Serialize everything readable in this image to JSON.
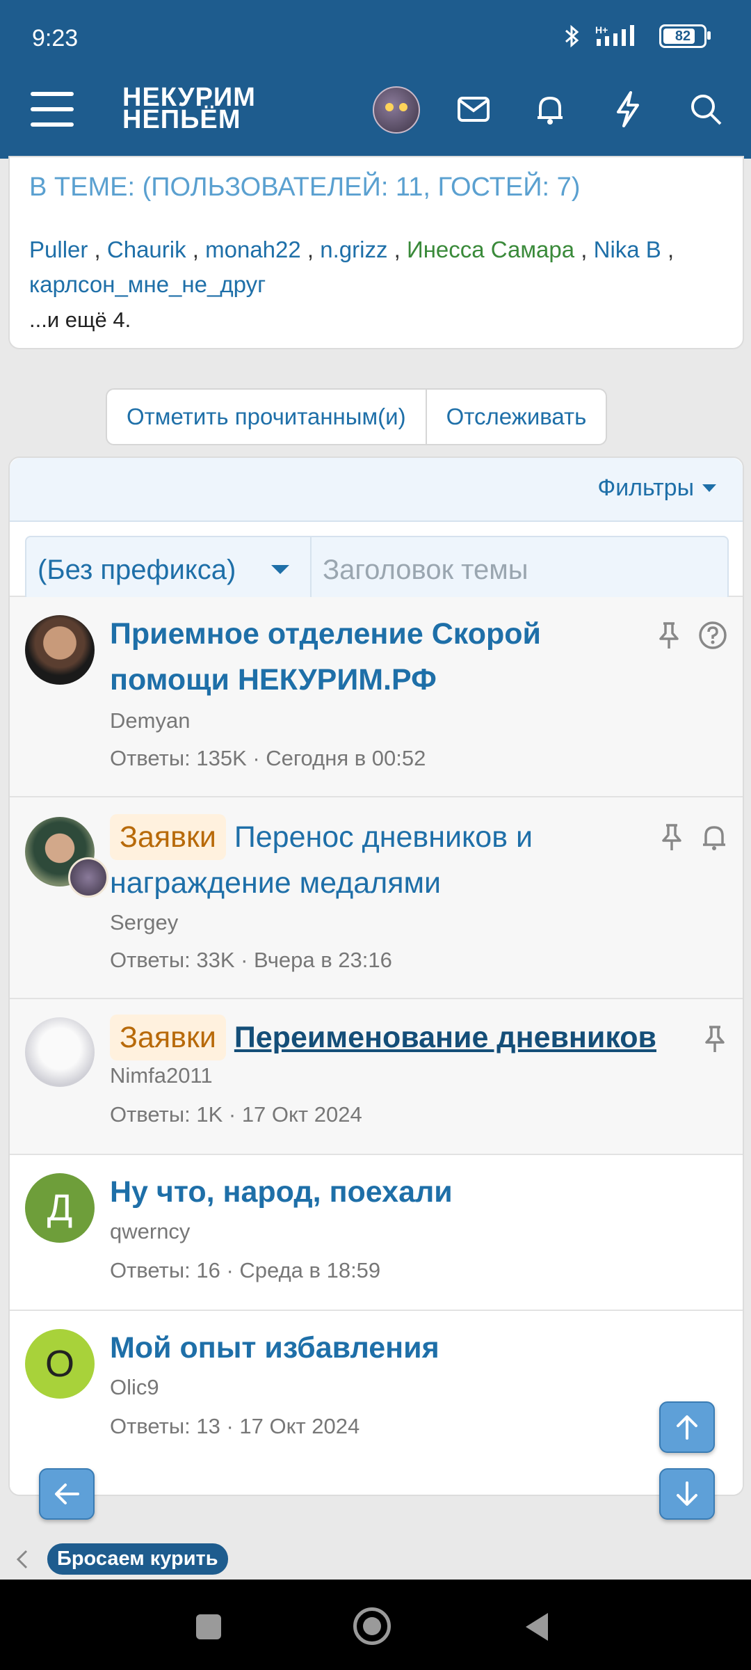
{
  "status_bar": {
    "time": "9:23",
    "battery": "82",
    "battery_level": 0.82,
    "network": "H+"
  },
  "header": {
    "logo_line1": "НЕКУРИМ",
    "logo_line2": "НЕПЬЁМ"
  },
  "in_theme": {
    "title": "В ТЕМЕ: (ПОЛЬЗОВАТЕЛЕЙ: 11, ГОСТЕЙ: 7)",
    "users": [
      "Puller",
      "Chaurik",
      "monah22",
      "n.grizz",
      "Инесса Самара",
      "Nika B",
      "карлсон_мне_не_друг"
    ],
    "more": "...и ещё 4."
  },
  "actions": {
    "mark_read": "Отметить прочитанным(и)",
    "watch": "Отслеживать"
  },
  "list": {
    "filters_label": "Фильтры",
    "prefix_value": "(Без префикса)",
    "title_placeholder": "Заголовок темы"
  },
  "threads": [
    {
      "title": "Приемное отделение Скорой помощи НЕКУРИМ.РФ",
      "author": "Demyan",
      "meta": "Ответы: 135K · Сегодня в 00:52",
      "prefix": ""
    },
    {
      "title": "Перенос дневников и награждение медалями",
      "author": "Sergey",
      "meta": "Ответы: 33K · Вчера в 23:16",
      "prefix": "Заявки"
    },
    {
      "title": "Переименование дневников",
      "author": "Nimfa2011",
      "meta": "Ответы: 1K · 17 Окт 2024",
      "prefix": "Заявки"
    },
    {
      "title": "Ну что, народ, поехали",
      "author": "qwerncy",
      "meta": "Ответы: 16 · Среда в 18:59",
      "prefix": "",
      "avatar_letter": "Д",
      "avatar_color": "#6e9e3a"
    },
    {
      "title": "Мой опыт избавления",
      "author": "Olic9",
      "meta": "Ответы: 13 · 17 Окт 2024",
      "prefix": "",
      "avatar_letter": "O",
      "avatar_color": "#a8d23a"
    }
  ],
  "breadcrumb": {
    "current": "Бросаем курить"
  },
  "colors": {
    "header": "#1e5c8e",
    "link": "#1e6fa8",
    "accent_fab": "#5ea0d8"
  }
}
